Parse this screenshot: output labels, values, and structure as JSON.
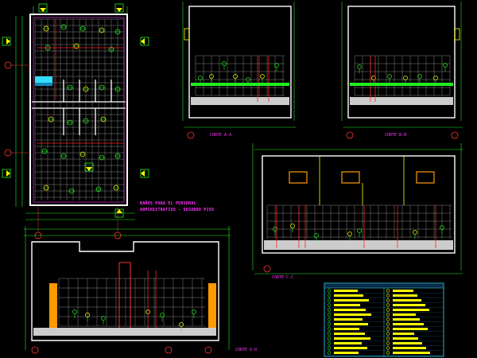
{
  "drawing": {
    "background": "#000000",
    "plan_title_line1": "BAÑOS PARA EL PERSONAL",
    "plan_title_line2": "ADMINISTRATIVO - SEGUNDO PISO",
    "section_labels": {
      "aa": "CORTE A-A",
      "bb": "CORTE B-B",
      "cc": "CORTE C-C",
      "dd": "CORTE D-D"
    }
  },
  "colors": {
    "wall": "#ffffff",
    "tile_grid": "#cfcfcf",
    "magenta": "#ff33ff",
    "green": "#22ee22",
    "yellow": "#ffff00",
    "red": "#ff2222",
    "cyan": "#33ddff",
    "orange": "#ff9900",
    "blue": "#3333ff"
  },
  "legend": {
    "rows": 14
  }
}
